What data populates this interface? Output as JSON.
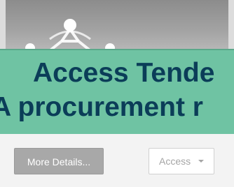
{
  "banner": {
    "title": "Access Tende",
    "subtitle": "A procurement r"
  },
  "buttons": {
    "details_label": "More Details...",
    "access_label": "Access"
  },
  "icons": {
    "thumbnail_logo": "people-network-icon",
    "access_caret": "chevron-down-icon"
  },
  "colors": {
    "banner_background": "#6fc3a3",
    "banner_text": "#0b3d58",
    "details_button": "#a8a8a8",
    "access_button_text": "#a5a5a5"
  }
}
